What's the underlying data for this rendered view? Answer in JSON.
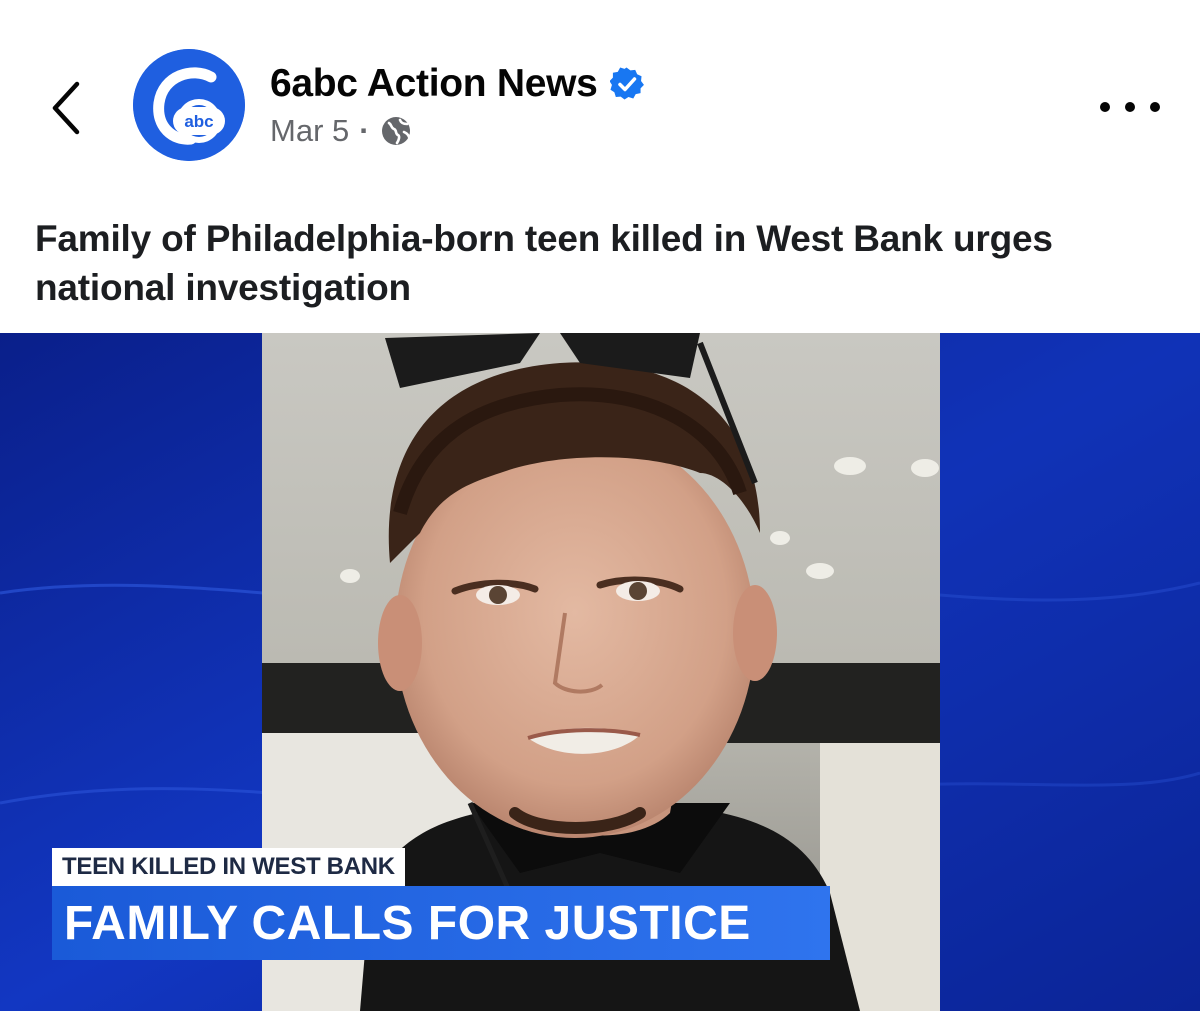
{
  "header": {
    "page_name": "6abc Action News",
    "date": "Mar 5",
    "separator": "·",
    "avatar_logo_text": "abc",
    "icons": {
      "back": "chevron-left-icon",
      "verified": "verified-badge-icon",
      "audience": "globe-icon",
      "more": "more-horizontal-icon"
    }
  },
  "post": {
    "text": "Family of Philadelphia-born teen killed in West Bank urges national investigation"
  },
  "media": {
    "lower_third_top": "TEEN KILLED IN WEST BANK",
    "lower_third_main": "FAMILY CALLS FOR JUSTICE"
  },
  "colors": {
    "brand_blue": "#1f5fe0",
    "verified_blue": "#1877f2",
    "secondary_text": "#65676b",
    "background_blue": "#0b2aa8"
  }
}
